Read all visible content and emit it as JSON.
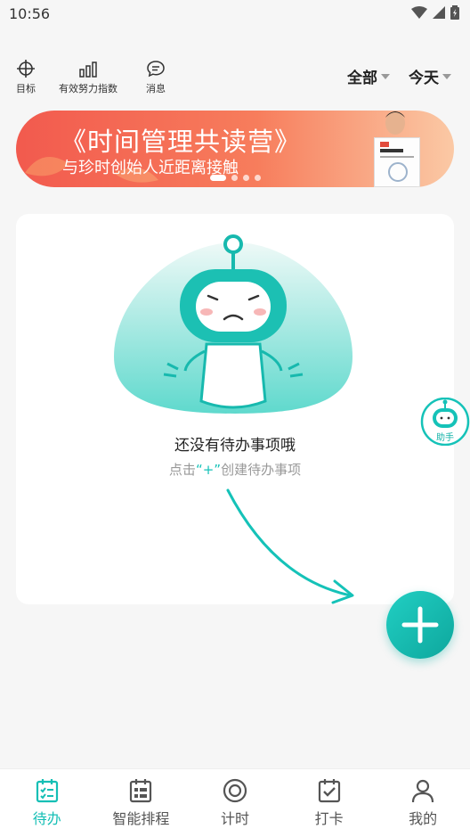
{
  "status_bar": {
    "time": "10:56"
  },
  "toolbar": {
    "items": [
      {
        "label": "目标",
        "icon": "target-icon"
      },
      {
        "label": "有效努力指数",
        "icon": "bar-chart-icon"
      },
      {
        "label": "消息",
        "icon": "message-icon"
      }
    ],
    "filter_scope": "全部",
    "filter_date": "今天"
  },
  "banner": {
    "title": "《时间管理共读营》",
    "subtitle": "与珍时创始人近距离接触",
    "slide_count": 4,
    "active_slide": 1
  },
  "empty_state": {
    "title": "还没有待办事项哦",
    "hint_prefix": "点击",
    "hint_plus": "“+”",
    "hint_suffix": "创建待办事项"
  },
  "assistant": {
    "label": "助手"
  },
  "fab": {
    "icon": "plus-icon"
  },
  "tabs": [
    {
      "label": "待办",
      "icon": "todo-icon",
      "active": true
    },
    {
      "label": "智能排程",
      "icon": "schedule-icon",
      "active": false
    },
    {
      "label": "计时",
      "icon": "timer-icon",
      "active": false
    },
    {
      "label": "打卡",
      "icon": "checkin-icon",
      "active": false
    },
    {
      "label": "我的",
      "icon": "profile-icon",
      "active": false
    }
  ],
  "colors": {
    "accent": "#15C2B8",
    "banner": "#F25A4E"
  }
}
